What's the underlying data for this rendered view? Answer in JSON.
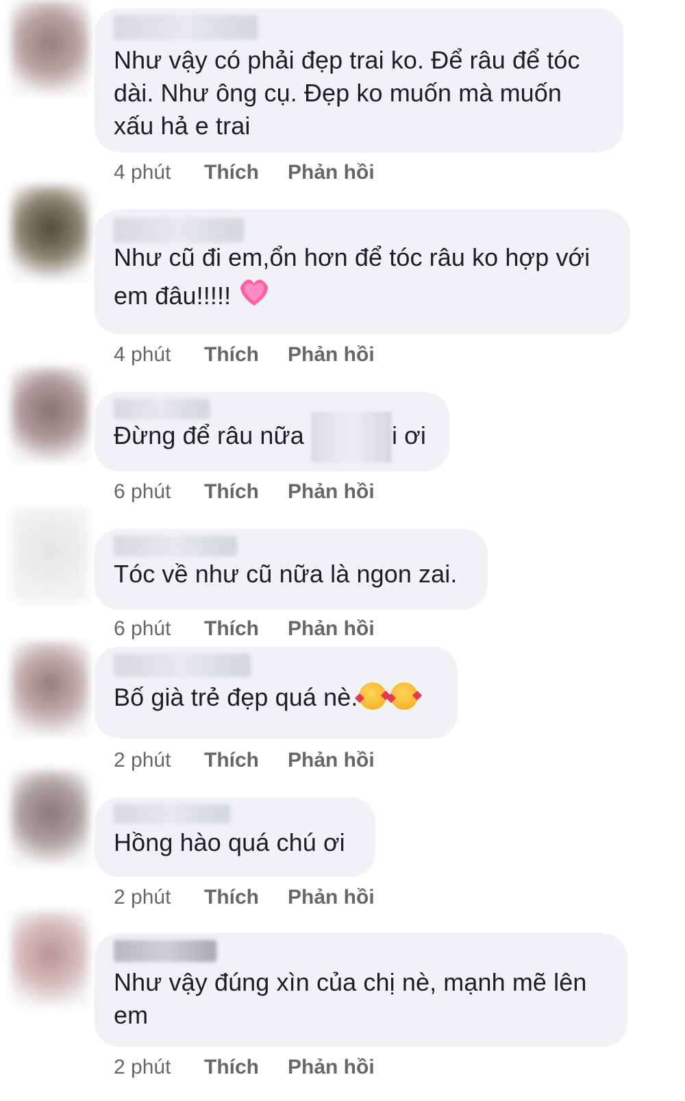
{
  "comments": [
    {
      "text": "Như vậy có phải đẹp trai ko. Để râu để tóc\ndài. Như ông cụ. Đẹp ko muốn mà muốn\nxấu hả e trai",
      "time": "4 phút",
      "like": "Thích",
      "reply": "Phản hồi"
    },
    {
      "text_before": "Như cũ đi em,ổn hơn để tóc râu ko hợp với\nem đâu!!!!! ",
      "emoji": "growing-heart-icon",
      "time": "4 phút",
      "like": "Thích",
      "reply": "Phản hồi"
    },
    {
      "text_before": "Đừng để râu nữa ",
      "text_after": "i ơi",
      "time": "6 phút",
      "like": "Thích",
      "reply": "Phản hồi"
    },
    {
      "text": "Tóc về như cũ nữa là ngon zai.",
      "time": "6 phút",
      "like": "Thích",
      "reply": "Phản hồi"
    },
    {
      "text_before": "Bố già trẻ đẹp quá nè.",
      "emoji": "smiling-face-with-hearts-icon",
      "time": "2 phút",
      "like": "Thích",
      "reply": "Phản hồi"
    },
    {
      "text": "Hồng hào quá chú ơi",
      "time": "2 phút",
      "like": "Thích",
      "reply": "Phản hồi"
    },
    {
      "text": "Như vậy đúng xìn của chị nè, mạnh mẽ lên\nem",
      "time": "2 phút",
      "like": "Thích",
      "reply": "Phản hồi"
    }
  ],
  "colors": {
    "bubble": "#f0f2f5",
    "text": "#1c1e21",
    "meta": "#65676b"
  }
}
